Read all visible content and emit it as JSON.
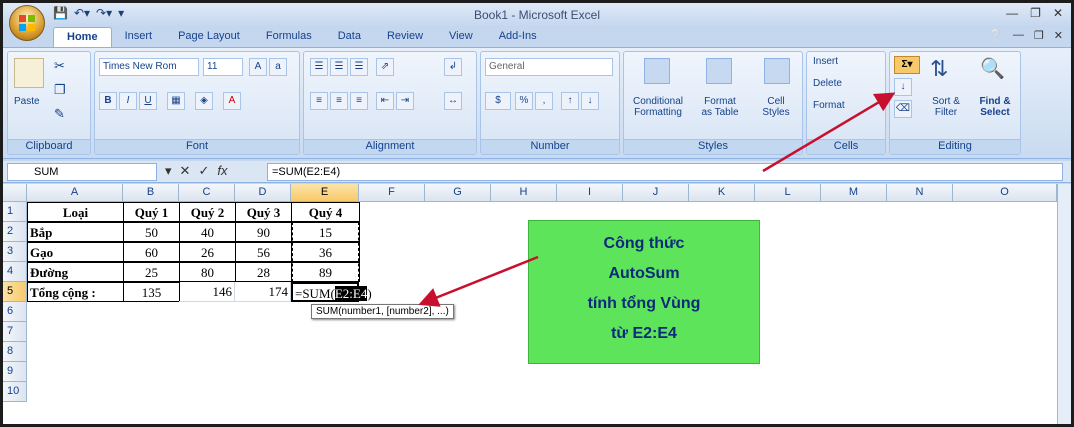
{
  "window": {
    "title": "Book1 - Microsoft Excel"
  },
  "tabs": [
    "Home",
    "Insert",
    "Page Layout",
    "Formulas",
    "Data",
    "Review",
    "View",
    "Add-Ins"
  ],
  "ribbon": {
    "clipboard": {
      "label": "Clipboard",
      "paste": "Paste"
    },
    "font": {
      "label": "Font",
      "name": "Times New Rom",
      "size": "11"
    },
    "alignment": {
      "label": "Alignment"
    },
    "number": {
      "label": "Number",
      "format": "General",
      "currency": "$",
      "percent": "%",
      "comma": ","
    },
    "styles": {
      "label": "Styles",
      "conditional": "Conditional",
      "formatting": "Formatting",
      "format_as": "Format",
      "as_table": "as Table",
      "cell_styles": "Cell",
      "styles_word": "Styles"
    },
    "cells": {
      "label": "Cells",
      "insert": "Insert",
      "delete": "Delete",
      "format": "Format"
    },
    "editing": {
      "label": "Editing",
      "sort": "Sort &",
      "filter": "Filter",
      "find": "Find &",
      "select": "Select"
    }
  },
  "formula_bar": {
    "name_box": "SUM",
    "formula": "=SUM(E2:E4)"
  },
  "columns": [
    "A",
    "B",
    "C",
    "D",
    "E",
    "F",
    "G",
    "H",
    "I",
    "J",
    "K",
    "L",
    "M",
    "N",
    "O"
  ],
  "rows": [
    "1",
    "2",
    "3",
    "4",
    "5",
    "6",
    "7",
    "8",
    "9",
    "10"
  ],
  "sheet": {
    "headers": [
      "Loại",
      "Quý 1",
      "Quý 2",
      "Quý 3",
      "Quý 4"
    ],
    "data": [
      [
        "Bắp",
        "50",
        "40",
        "90",
        "15"
      ],
      [
        "Gạo",
        "60",
        "26",
        "56",
        "36"
      ],
      [
        "Đường",
        "25",
        "80",
        "28",
        "89"
      ]
    ],
    "total_label": "Tổng cộng :",
    "totals": [
      "135",
      "146",
      "174"
    ],
    "editing_prefix": "=SUM(",
    "editing_range": "E2:E4",
    "editing_suffix": ")"
  },
  "tooltip": {
    "text": "SUM(number1, [number2], ...)"
  },
  "callout": {
    "lines": [
      "Công thức",
      "AutoSum",
      "tính tổng Vùng",
      "từ E2:E4"
    ]
  },
  "colors": {
    "callout": "#5ee45a",
    "arrow": "#c8102e",
    "autosum_highlight": "#f8c96a"
  }
}
